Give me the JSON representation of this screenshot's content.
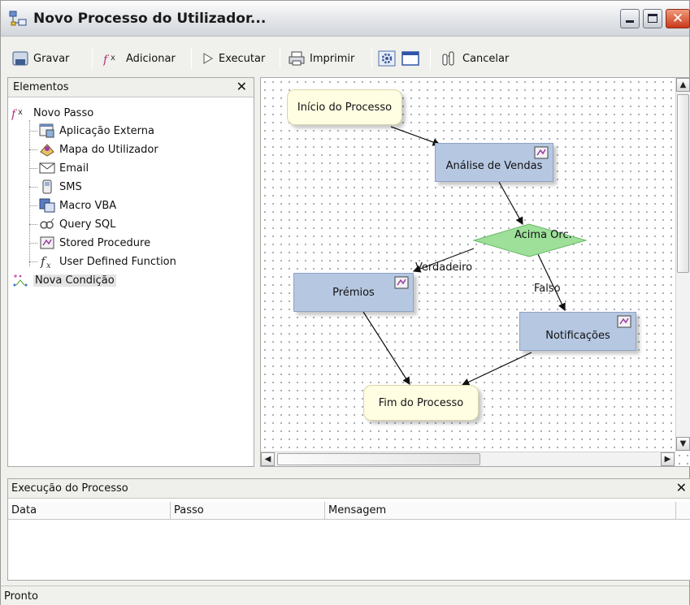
{
  "window": {
    "title": "Novo Processo do Utilizador..."
  },
  "toolbar": {
    "save_label": "Gravar",
    "add_label": "Adicionar",
    "run_label": "Executar",
    "print_label": "Imprimir",
    "cancel_label": "Cancelar"
  },
  "elements_panel": {
    "title": "Elementos",
    "close": "✕",
    "items": [
      {
        "label": "Novo Passo",
        "icon": "function-step-icon"
      },
      {
        "label": "Aplicação Externa",
        "icon": "external-app-icon"
      },
      {
        "label": "Mapa do Utilizador",
        "icon": "user-map-icon"
      },
      {
        "label": "Email",
        "icon": "email-icon"
      },
      {
        "label": "SMS",
        "icon": "sms-phone-icon"
      },
      {
        "label": "Macro VBA",
        "icon": "macro-vba-icon"
      },
      {
        "label": "Query SQL",
        "icon": "sql-query-icon"
      },
      {
        "label": "Stored Procedure",
        "icon": "stored-procedure-icon"
      },
      {
        "label": "User Defined Function",
        "icon": "fx-function-icon"
      },
      {
        "label": "Nova Condição",
        "icon": "condition-icon"
      }
    ]
  },
  "flow": {
    "nodes": {
      "start": "Início do Processo",
      "sales": "Análise de Vendas",
      "decision": "Acima Orc.",
      "prizes": "Prémios",
      "notifications": "Notificações",
      "end": "Fim do Processo"
    },
    "edge_labels": {
      "true": "Verdadeiro",
      "false": "Falso"
    }
  },
  "execution_panel": {
    "title": "Execução do Processo",
    "close": "✕",
    "columns": [
      "Data",
      "Passo",
      "Mensagem"
    ]
  },
  "status": {
    "text": "Pronto"
  },
  "colors": {
    "step_fill": "#b6c7e2",
    "terminal_fill": "#fffde2",
    "decision_fill": "#9ee09a"
  }
}
